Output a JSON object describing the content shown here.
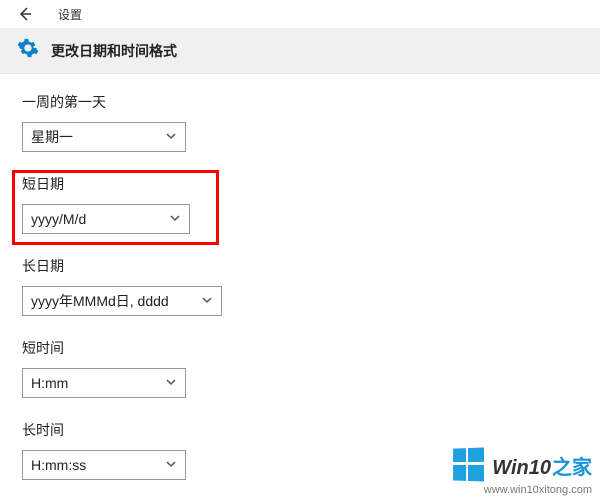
{
  "titlebar": {
    "title": "设置"
  },
  "header": {
    "title": "更改日期和时间格式"
  },
  "fields": {
    "first_day": {
      "label": "一周的第一天",
      "value": "星期一"
    },
    "short_date": {
      "label": "短日期",
      "value": "yyyy/M/d"
    },
    "long_date": {
      "label": "长日期",
      "value": "yyyy年MMMd日, dddd"
    },
    "short_time": {
      "label": "短时间",
      "value": "H:mm"
    },
    "long_time": {
      "label": "长时间",
      "value": "H:mm:ss"
    }
  },
  "watermark": {
    "brand_prefix": "Win10",
    "brand_suffix": "之家",
    "url": "www.win10xitong.com"
  },
  "colors": {
    "highlight": "#ff0000",
    "accent": "#1fa1e0"
  }
}
